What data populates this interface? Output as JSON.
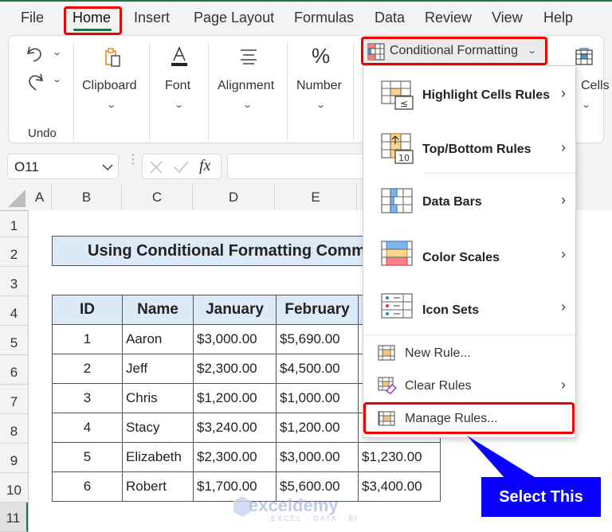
{
  "menu_tabs": [
    {
      "label": "File"
    },
    {
      "label": "Home",
      "active": true
    },
    {
      "label": "Insert"
    },
    {
      "label": "Page Layout"
    },
    {
      "label": "Formulas"
    },
    {
      "label": "Data"
    },
    {
      "label": "Review"
    },
    {
      "label": "View"
    },
    {
      "label": "Help"
    }
  ],
  "ribbon": {
    "undo_group_label": "Undo",
    "groups": [
      {
        "label": "Clipboard",
        "icon": "clipboard-icon"
      },
      {
        "label": "Font",
        "icon": "font-color-icon"
      },
      {
        "label": "Alignment",
        "icon": "align-icon"
      },
      {
        "label": "Number",
        "icon": "percent-icon"
      }
    ],
    "conditional_formatting_label": "Conditional Formatting",
    "cells_label": "Cells"
  },
  "formula_bar": {
    "name_box": "O11",
    "fx_label": "fx",
    "formula_value": ""
  },
  "columns": [
    "A",
    "B",
    "C",
    "D",
    "E"
  ],
  "rows": [
    "1",
    "2",
    "3",
    "4",
    "5",
    "6",
    "7",
    "8",
    "9",
    "10",
    "11"
  ],
  "sheet": {
    "title": "Using Conditional Formatting Comm",
    "table_headers": [
      "ID",
      "Name",
      "January",
      "February",
      ""
    ],
    "table_rows": [
      [
        "1",
        "Aaron",
        "$3,000.00",
        "$5,690.00",
        ""
      ],
      [
        "2",
        "Jeff",
        "$2,300.00",
        "$4,500.00",
        ""
      ],
      [
        "3",
        "Chris",
        "$1,200.00",
        "$1,000.00",
        ""
      ],
      [
        "4",
        "Stacy",
        "$3,240.00",
        "$1,200.00",
        ""
      ],
      [
        "5",
        "Elizabeth",
        "$2,300.00",
        "$3,000.00",
        "$1,230.00"
      ],
      [
        "6",
        "Robert",
        "$1,700.00",
        "$5,600.00",
        "$3,400.00"
      ]
    ]
  },
  "cf_menu": {
    "items": [
      {
        "label": "Highlight Cells Rules",
        "icon": "highlight-cells-icon",
        "submenu": true
      },
      {
        "label": "Top/Bottom Rules",
        "icon": "top-bottom-icon",
        "submenu": true
      },
      {
        "label": "Data Bars",
        "icon": "data-bars-icon",
        "submenu": true
      },
      {
        "label": "Color Scales",
        "icon": "color-scales-icon",
        "submenu": true
      },
      {
        "label": "Icon Sets",
        "icon": "icon-sets-icon",
        "submenu": true
      },
      {
        "label": "New Rule...",
        "icon": "new-rule-icon",
        "submenu": false
      },
      {
        "label": "Clear Rules",
        "icon": "clear-rules-icon",
        "submenu": true
      },
      {
        "label": "Manage Rules...",
        "icon": "manage-rules-icon",
        "submenu": false
      }
    ]
  },
  "callout": {
    "label": "Select This"
  },
  "watermark": {
    "brand": "exceldemy",
    "tagline": "EXCEL · DATA · BI"
  },
  "colors": {
    "highlight_red": "#ee0000",
    "callout_blue": "#0a00ff",
    "excel_green": "#217346",
    "header_fill": "#dce9f6"
  }
}
